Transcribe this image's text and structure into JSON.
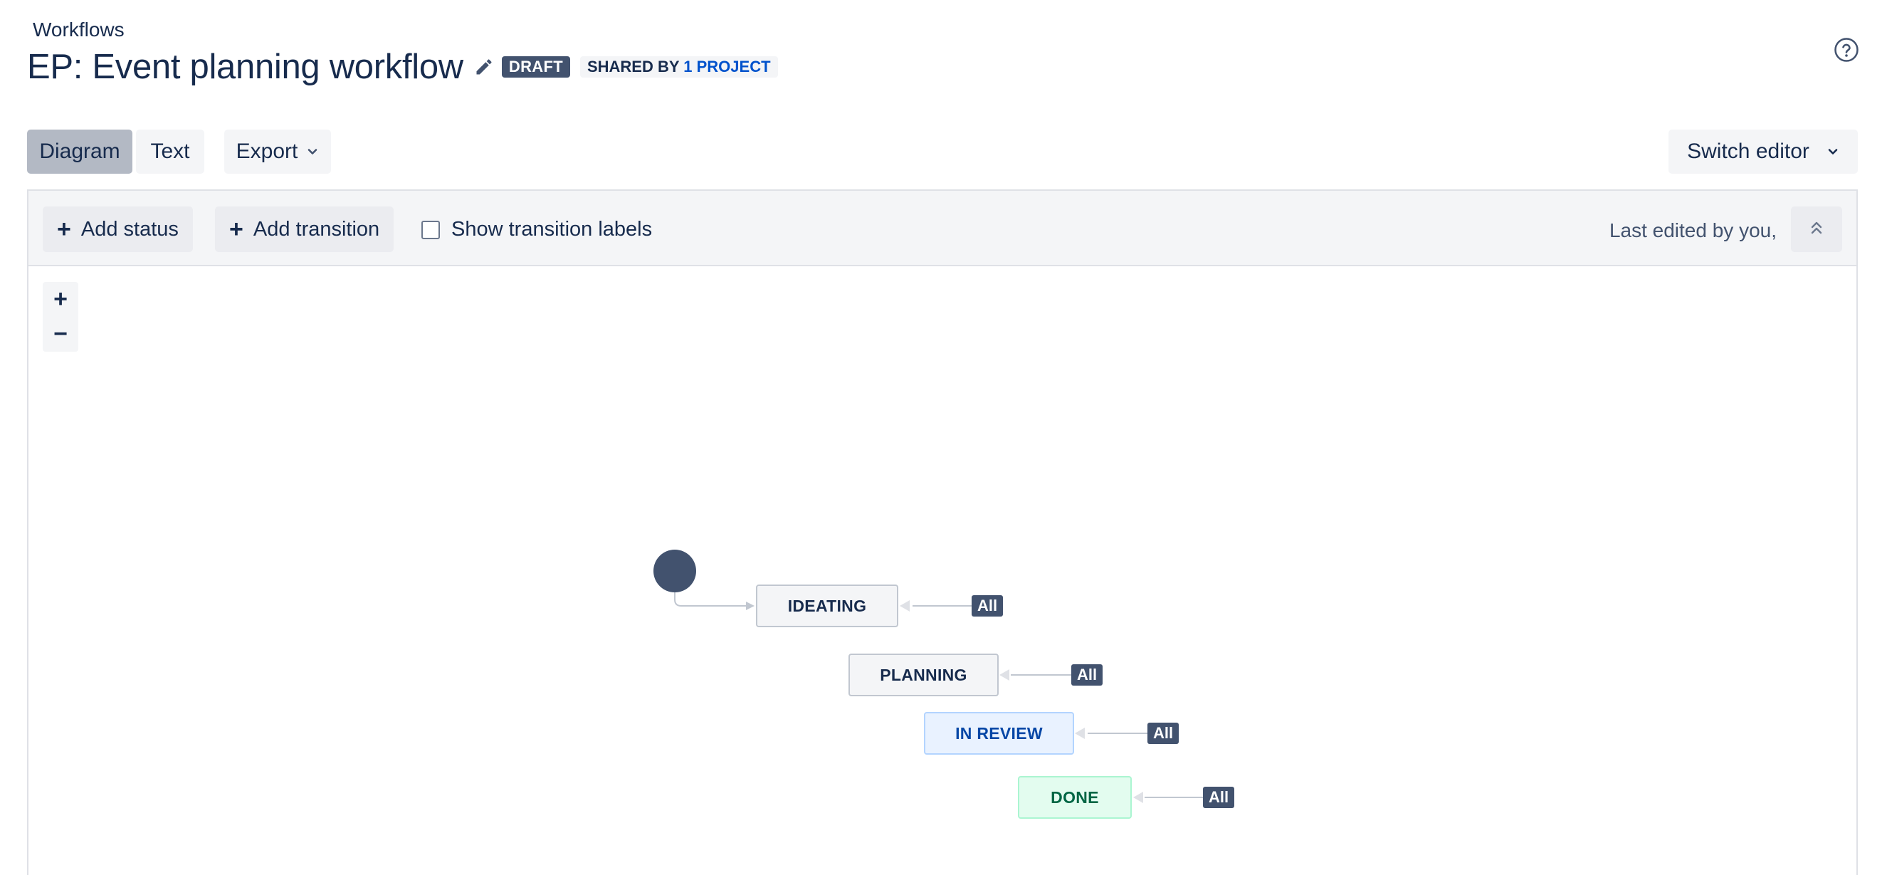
{
  "header": {
    "breadcrumb": "Workflows",
    "title": "EP: Event planning workflow",
    "draft_label": "DRAFT",
    "shared_prefix": "SHARED BY",
    "shared_link": "1 PROJECT"
  },
  "view_tabs": {
    "diagram": "Diagram",
    "text": "Text"
  },
  "export_label": "Export",
  "switch_editor_label": "Switch editor",
  "editor_toolbar": {
    "add_status": "Add status",
    "add_transition": "Add transition",
    "show_labels": "Show transition labels",
    "show_labels_checked": false,
    "last_edited": "Last edited by you,"
  },
  "zoom": {
    "in": "+",
    "out": "−"
  },
  "statuses": [
    {
      "label": "IDEATING",
      "badge": "All",
      "category": "todo"
    },
    {
      "label": "PLANNING",
      "badge": "All",
      "category": "todo"
    },
    {
      "label": "IN REVIEW",
      "badge": "All",
      "category": "in-progress"
    },
    {
      "label": "DONE",
      "badge": "All",
      "category": "done"
    }
  ],
  "colors": {
    "accent": "#0052cc",
    "dark": "#42526e",
    "todo_bg": "#f4f5f7",
    "in_progress_bg": "#e9f2ff",
    "done_bg": "#e3fcef"
  },
  "icons": {
    "edit": "pencil-icon",
    "help": "question-circle-icon",
    "chevron": "chevron-down-icon",
    "collapse": "chevron-double-up-icon"
  }
}
